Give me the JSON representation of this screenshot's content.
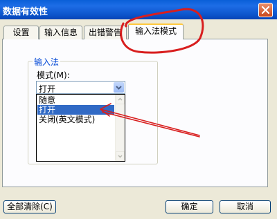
{
  "window": {
    "title": "数据有效性"
  },
  "tabs": [
    {
      "label": "设置"
    },
    {
      "label": "输入信息"
    },
    {
      "label": "出错警告"
    },
    {
      "label": "输入法模式"
    }
  ],
  "ime_group": {
    "legend": "输入法",
    "mode_label": "模式(M):",
    "selected_value": "打开",
    "options": [
      "随意",
      "打开",
      "关闭(英文模式)"
    ],
    "highlighted_option": "打开"
  },
  "buttons": {
    "clear_all": "全部清除(C)",
    "ok": "确定",
    "cancel": "取消"
  },
  "colors": {
    "title_bar": "#0a5fd8",
    "annotation": "#d81e1e",
    "selection": "#316ac5"
  }
}
